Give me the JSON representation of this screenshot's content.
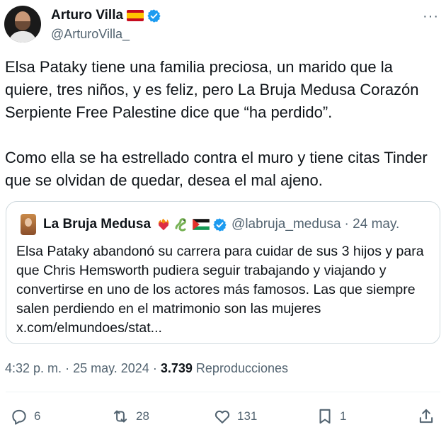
{
  "author": {
    "display_name": "Arturo Villa",
    "handle": "@ArturoVilla_",
    "flag_icon": "spain-flag",
    "verified_icon": "verified-badge"
  },
  "tweet": {
    "text": "Elsa Pataky tiene una familia preciosa, un marido que la quiere, tres niños, y es feliz, pero La Bruja Medusa Corazón Serpiente Free Palestine dice que “ha perdido”.\n\nComo ella se ha estrellado contra el muro y tiene citas Tinder que se olvidan de quedar, desea el mal ajeno."
  },
  "quote": {
    "display_name": "La Bruja Medusa",
    "emoji_icons": [
      "flaming-heart-icon",
      "snake-icon",
      "palestine-flag"
    ],
    "handle": "@labruja_medusa",
    "date": "· 24 may.",
    "text": "Elsa Pataky abandonó su carrera para cuidar de sus 3 hijos y para que Chris Hemsworth pudiera seguir trabajando y viajando y convertirse en uno de los actores más famosos. Las que siempre salen perdiendo en el matrimonio son las mujeres x.com/elmundoes/stat..."
  },
  "meta": {
    "time": "4:32 p. m.",
    "separator": "·",
    "date": "25 may. 2024",
    "views_count": "3.739",
    "views_label": "Reproducciones"
  },
  "actions": {
    "replies": "6",
    "reposts": "28",
    "likes": "131",
    "bookmarks": "1"
  },
  "colors": {
    "verified": "#1d9bf0",
    "secondary_text": "#536471",
    "border": "#cfd9de"
  }
}
